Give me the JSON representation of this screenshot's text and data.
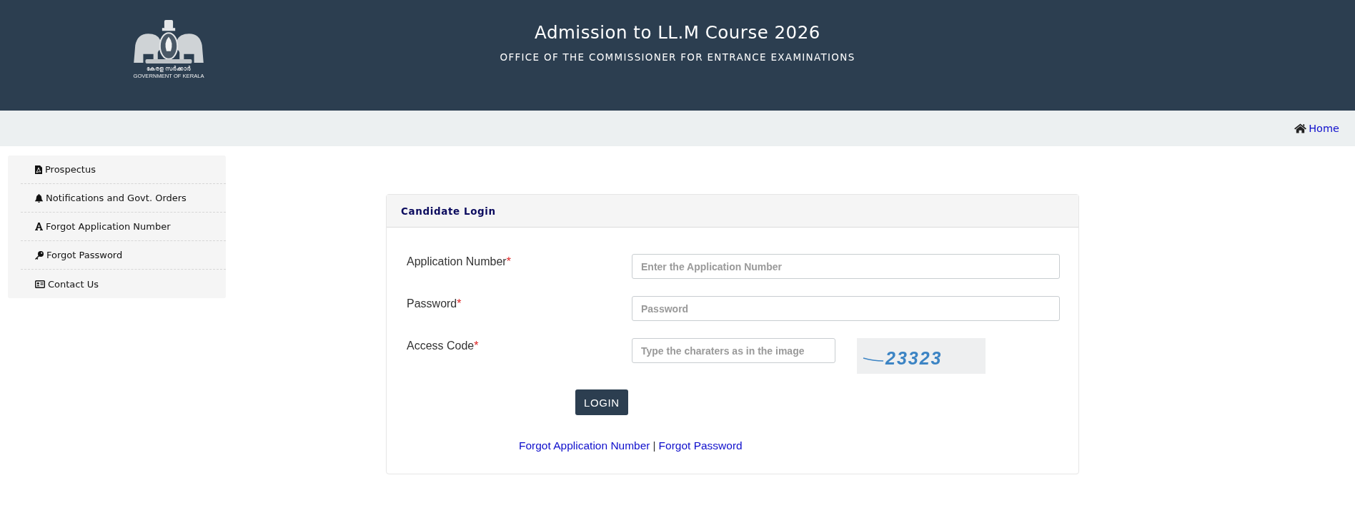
{
  "header": {
    "logo": {
      "native_caption": "കേരള സർക്കാർ",
      "caption": "GOVERNMENT OF KERALA"
    },
    "title": "Admission to LL.M Course 2026",
    "subtitle": "OFFICE OF THE COMMISSIONER FOR ENTRANCE EXAMINATIONS"
  },
  "nav": {
    "home": "Home"
  },
  "sidebar": {
    "items": [
      {
        "label": "Prospectus"
      },
      {
        "label": "Notifications and Govt. Orders"
      },
      {
        "label": "Forgot Application Number"
      },
      {
        "label": "Forgot Password"
      },
      {
        "label": "Contact Us"
      }
    ]
  },
  "login": {
    "title": "Candidate Login",
    "fields": [
      {
        "kind": "text",
        "label": "Application Number",
        "required_mark": "*",
        "placeholder": "Enter the Application Number"
      },
      {
        "kind": "password",
        "label": "Password",
        "required_mark": "*",
        "placeholder": "Password"
      },
      {
        "kind": "captcha",
        "label": "Access Code",
        "required_mark": "*",
        "placeholder": "Type the charaters as in the image",
        "captcha": "23323"
      }
    ],
    "button": "LOGIN",
    "links": [
      "Forgot Application Number",
      "Forgot Password"
    ],
    "link_separator": "|"
  }
}
